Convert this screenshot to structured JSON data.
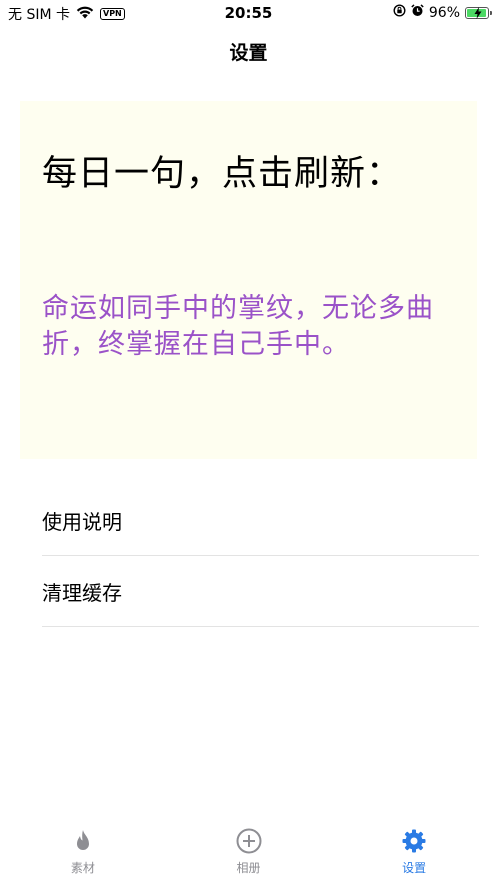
{
  "status_bar": {
    "carrier": "无 SIM 卡",
    "vpn": "VPN",
    "time": "20:55",
    "battery": "96%",
    "battery_level": 0.96
  },
  "nav": {
    "title": "设置"
  },
  "daily_quote": {
    "heading": "每日一句，点击刷新：",
    "text": "命运如同手中的掌纹，无论多曲折，终掌握在自己手中。"
  },
  "menu": {
    "items": [
      {
        "label": "使用说明"
      },
      {
        "label": "清理缓存"
      }
    ]
  },
  "tab_bar": {
    "tabs": [
      {
        "label": "素材",
        "icon": "flame-icon"
      },
      {
        "label": "相册",
        "icon": "plus-circle-icon"
      },
      {
        "label": "设置",
        "icon": "gear-icon"
      }
    ],
    "active_index": 2
  },
  "colors": {
    "accent": "#2a7be4",
    "quote_text": "#9a52c8",
    "card_background": "#fefef0",
    "inactive_tab": "#8e8e93"
  }
}
